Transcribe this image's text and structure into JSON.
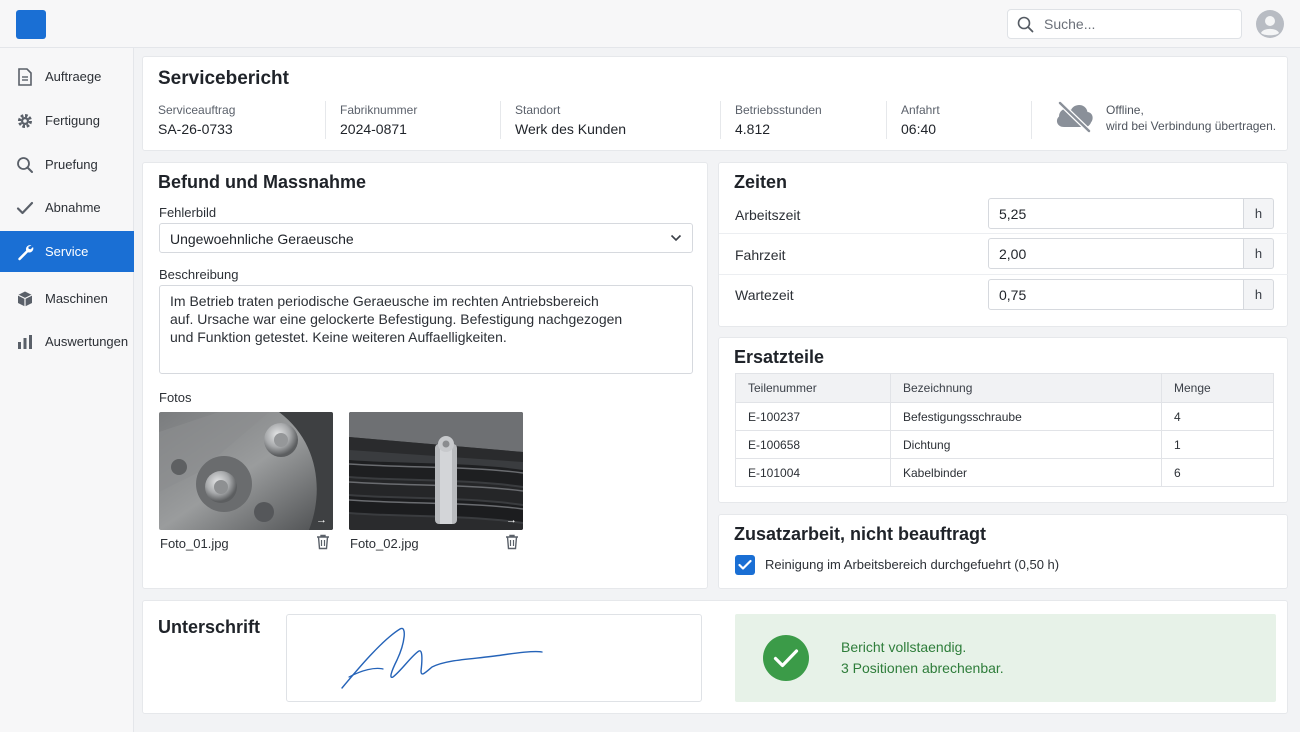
{
  "header": {
    "search_placeholder": "Suche..."
  },
  "sidebar": {
    "items": [
      {
        "label": "Auftraege",
        "icon": "document-icon"
      },
      {
        "label": "Fertigung",
        "icon": "gear-icon"
      },
      {
        "label": "Pruefung",
        "icon": "search-icon"
      },
      {
        "label": "Abnahme",
        "icon": "check-icon"
      },
      {
        "label": "Service",
        "icon": "wrench-icon",
        "active": true
      },
      {
        "label": "Maschinen",
        "icon": "cube-icon"
      },
      {
        "label": "Auswertungen",
        "icon": "bar-chart-icon"
      }
    ]
  },
  "report": {
    "title": "Servicebericht",
    "fields": [
      {
        "label": "Serviceauftrag",
        "value": "SA-26-0733"
      },
      {
        "label": "Fabriknummer",
        "value": "2024-0871"
      },
      {
        "label": "Standort",
        "value": "Werk des Kunden"
      },
      {
        "label": "Betriebsstunden",
        "value": "4.812"
      },
      {
        "label": "Anfahrt",
        "value": "06:40"
      }
    ],
    "offline_line1": "Offline,",
    "offline_line2": "wird bei Verbindung übertragen."
  },
  "findings": {
    "title": "Befund und Massnahme",
    "fault_label": "Fehlerbild",
    "fault_value": "Ungewoehnliche Geraeusche",
    "description_label": "Beschreibung",
    "description": "Im Betrieb traten periodische Geraeusche im rechten Antriebsbereich\nauf. Ursache war eine gelockerte Befestigung. Befestigung nachgezogen\nund Funktion getestet. Keine weiteren Auffaelligkeiten.",
    "photos_label": "Fotos",
    "photos": [
      {
        "name": "Foto_01.jpg"
      },
      {
        "name": "Foto_02.jpg"
      }
    ]
  },
  "times": {
    "title": "Zeiten",
    "rows": [
      {
        "label": "Arbeitszeit",
        "value": "5,25",
        "unit": "h"
      },
      {
        "label": "Fahrzeit",
        "value": "2,00",
        "unit": "h"
      },
      {
        "label": "Wartezeit",
        "value": "0,75",
        "unit": "h"
      }
    ]
  },
  "parts": {
    "title": "Ersatzteile",
    "headers": [
      "Teilenummer",
      "Bezeichnung",
      "Menge"
    ],
    "rows": [
      [
        "E-100237",
        "Befestigungsschraube",
        "4"
      ],
      [
        "E-100658",
        "Dichtung",
        "1"
      ],
      [
        "E-101004",
        "Kabelbinder",
        "6"
      ]
    ]
  },
  "extra": {
    "title": "Zusatzarbeit, nicht beauftragt",
    "item_label": "Reinigung im Arbeitsbereich durchgefuehrt (0,50 h)",
    "checked": true
  },
  "signature": {
    "title": "Unterschrift"
  },
  "status": {
    "line1": "Bericht vollstaendig.",
    "line2": "3 Positionen abrechenbar."
  },
  "colors": {
    "accent": "#1a6fd4",
    "success": "#3b9b48",
    "success_bg": "#e7f2e8"
  }
}
